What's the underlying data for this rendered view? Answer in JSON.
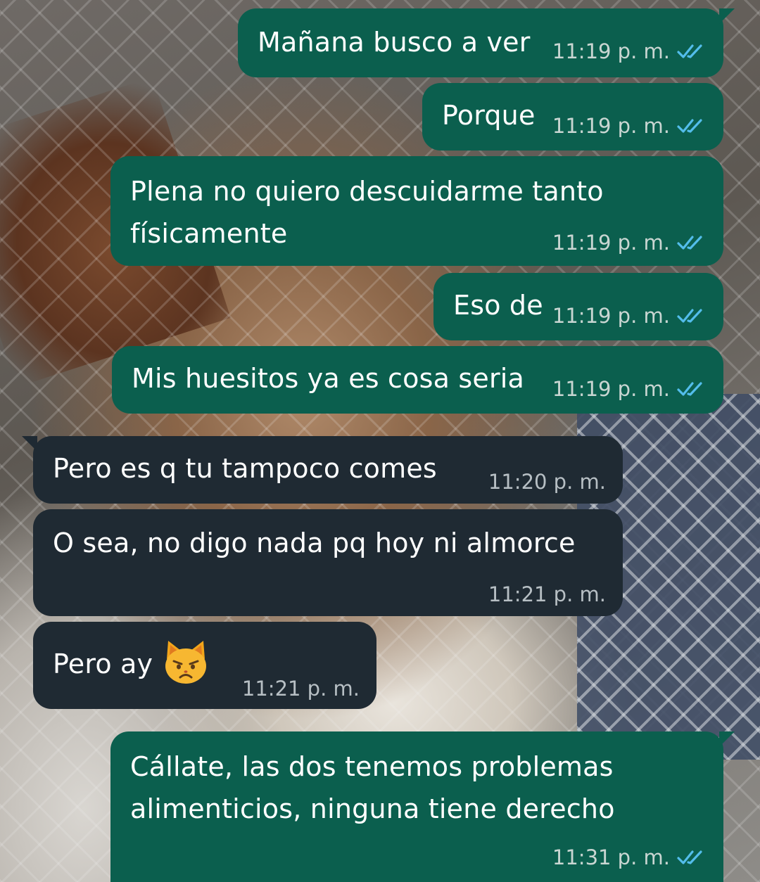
{
  "messages": [
    {
      "id": "m1",
      "direction": "outgoing",
      "lines": [
        "Mañana busco a ver"
      ],
      "time": "11:19 p. m.",
      "status": "read"
    },
    {
      "id": "m2",
      "direction": "outgoing",
      "lines": [
        "Porque"
      ],
      "time": "11:19 p. m.",
      "status": "read"
    },
    {
      "id": "m3",
      "direction": "outgoing",
      "lines": [
        "Plena no quiero descuidarme tanto",
        "físicamente"
      ],
      "time": "11:19 p. m.",
      "status": "read"
    },
    {
      "id": "m4",
      "direction": "outgoing",
      "lines": [
        "Eso de"
      ],
      "time": "11:19 p. m.",
      "status": "read"
    },
    {
      "id": "m5",
      "direction": "outgoing",
      "lines": [
        "Mis huesitos ya es cosa seria"
      ],
      "time": "11:19 p. m.",
      "status": "read"
    },
    {
      "id": "m6",
      "direction": "incoming",
      "lines": [
        "Pero es q tu tampoco comes"
      ],
      "time": "11:20 p. m."
    },
    {
      "id": "m7",
      "direction": "incoming",
      "lines": [
        "O sea, no digo nada pq hoy ni almorce"
      ],
      "time": "11:21 p. m."
    },
    {
      "id": "m8",
      "direction": "incoming",
      "lines": [
        "Pero ay"
      ],
      "emoji": "pouting-cat-face",
      "time": "11:21 p. m."
    },
    {
      "id": "m9",
      "direction": "outgoing",
      "lines": [
        "Cállate, las dos tenemos problemas",
        "alimenticios, ninguna tiene derecho"
      ],
      "time": "11:31 p. m.",
      "status": "read"
    }
  ],
  "colors": {
    "outgoing_bubble": "#0b5f4e",
    "incoming_bubble": "#1f2a33",
    "read_ticks": "#53bdeb",
    "text": "#ffffff"
  }
}
